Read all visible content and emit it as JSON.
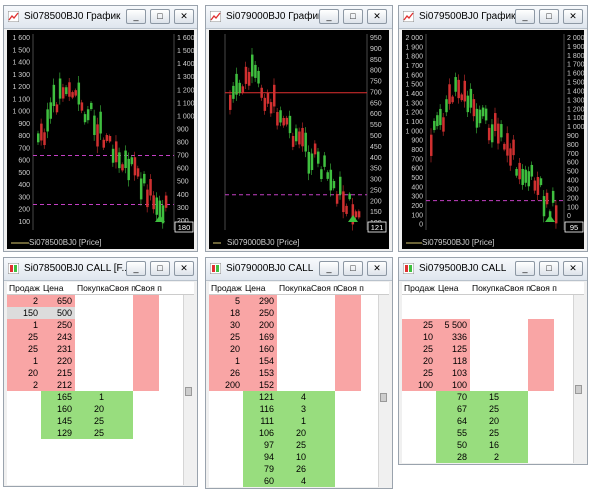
{
  "windows": [
    {
      "title": "Si078500BJ0 График",
      "legend": "Si078500BJ0 [Price]",
      "last_price": "180",
      "left_ticks": [
        "1 600",
        "1 500",
        "1 400",
        "1 300",
        "1 200",
        "1 100",
        "1 000",
        "900",
        "800",
        "700",
        "600",
        "500",
        "400",
        "300",
        "200",
        "100"
      ],
      "right_ticks": [
        "1 600",
        "1 500",
        "1 400",
        "1 300",
        "1 200",
        "1 100",
        "1 000",
        "900",
        "800",
        "700",
        "600",
        "500",
        "400",
        "300",
        "200"
      ]
    },
    {
      "title": "Si079000BJ0 График",
      "legend": "Si079000BJ0 [Price]",
      "last_price": "121",
      "left_ticks": [],
      "right_ticks": [
        "950",
        "900",
        "850",
        "800",
        "750",
        "700",
        "650",
        "600",
        "550",
        "500",
        "450",
        "400",
        "350",
        "300",
        "250",
        "200",
        "150",
        "100"
      ]
    },
    {
      "title": "Si079500BJ0 График",
      "legend": "Si079500BJ0 [Price]",
      "last_price": "95",
      "left_ticks": [
        "2 000",
        "1 900",
        "1 800",
        "1 700",
        "1 600",
        "1 500",
        "1 400",
        "1 300",
        "1 200",
        "1 100",
        "1 000",
        "900",
        "800",
        "700",
        "600",
        "500",
        "400",
        "300",
        "200",
        "100",
        "0"
      ],
      "right_ticks": [
        "2 000",
        "1 900",
        "1 800",
        "1 700",
        "1 600",
        "1 500",
        "1 400",
        "1 300",
        "1 200",
        "1 100",
        "1 000",
        "900",
        "800",
        "700",
        "600",
        "500",
        "400",
        "300",
        "200",
        "100",
        "0",
        "-100"
      ]
    }
  ],
  "books": [
    {
      "title": "Si078500BJ0 CALL [F...",
      "headers": [
        "Продаж",
        "Цена",
        "Покупка",
        "Своя п",
        "Своя п"
      ],
      "rows": [
        {
          "sell": "2",
          "price": "650",
          "buy": "",
          "t": "ask"
        },
        {
          "sell": "150",
          "price": "500",
          "buy": "",
          "t": "sel"
        },
        {
          "sell": "1",
          "price": "250",
          "buy": "",
          "t": "ask"
        },
        {
          "sell": "25",
          "price": "243",
          "buy": "",
          "t": "ask"
        },
        {
          "sell": "25",
          "price": "231",
          "buy": "",
          "t": "ask"
        },
        {
          "sell": "1",
          "price": "220",
          "buy": "",
          "t": "ask"
        },
        {
          "sell": "20",
          "price": "215",
          "buy": "",
          "t": "ask"
        },
        {
          "sell": "2",
          "price": "212",
          "buy": "",
          "t": "ask"
        },
        {
          "sell": "",
          "price": "165",
          "buy": "1",
          "t": "bid"
        },
        {
          "sell": "",
          "price": "160",
          "buy": "20",
          "t": "bid"
        },
        {
          "sell": "",
          "price": "145",
          "buy": "25",
          "t": "bid"
        },
        {
          "sell": "",
          "price": "129",
          "buy": "25",
          "t": "bid"
        }
      ]
    },
    {
      "title": "Si079000BJ0 CALL",
      "headers": [
        "Продаж",
        "Цена",
        "Покупка",
        "Своя п",
        "Своя п"
      ],
      "rows": [
        {
          "sell": "5",
          "price": "290",
          "buy": "",
          "t": "ask"
        },
        {
          "sell": "18",
          "price": "250",
          "buy": "",
          "t": "ask"
        },
        {
          "sell": "30",
          "price": "200",
          "buy": "",
          "t": "ask"
        },
        {
          "sell": "25",
          "price": "169",
          "buy": "",
          "t": "ask"
        },
        {
          "sell": "20",
          "price": "160",
          "buy": "",
          "t": "ask"
        },
        {
          "sell": "1",
          "price": "154",
          "buy": "",
          "t": "ask"
        },
        {
          "sell": "26",
          "price": "153",
          "buy": "",
          "t": "ask"
        },
        {
          "sell": "200",
          "price": "152",
          "buy": "",
          "t": "ask"
        },
        {
          "sell": "",
          "price": "121",
          "buy": "4",
          "t": "bid"
        },
        {
          "sell": "",
          "price": "116",
          "buy": "3",
          "t": "bid"
        },
        {
          "sell": "",
          "price": "111",
          "buy": "1",
          "t": "bid"
        },
        {
          "sell": "",
          "price": "106",
          "buy": "20",
          "t": "bid"
        },
        {
          "sell": "",
          "price": "97",
          "buy": "25",
          "t": "bid"
        },
        {
          "sell": "",
          "price": "94",
          "buy": "10",
          "t": "bid"
        },
        {
          "sell": "",
          "price": "79",
          "buy": "26",
          "t": "bid"
        },
        {
          "sell": "",
          "price": "60",
          "buy": "4",
          "t": "bid"
        }
      ]
    },
    {
      "title": "Si079500BJ0 CALL",
      "headers": [
        "Продаж",
        "Цена",
        "Покупка",
        "Своя п",
        "Своя п"
      ],
      "rows": [
        {
          "sell": "",
          "price": "",
          "buy": "",
          "t": "none"
        },
        {
          "sell": "",
          "price": "",
          "buy": "",
          "t": "none"
        },
        {
          "sell": "25",
          "price": "5 500",
          "buy": "",
          "t": "ask"
        },
        {
          "sell": "10",
          "price": "336",
          "buy": "",
          "t": "ask"
        },
        {
          "sell": "25",
          "price": "125",
          "buy": "",
          "t": "ask"
        },
        {
          "sell": "20",
          "price": "118",
          "buy": "",
          "t": "ask"
        },
        {
          "sell": "25",
          "price": "103",
          "buy": "",
          "t": "ask"
        },
        {
          "sell": "100",
          "price": "100",
          "buy": "",
          "t": "ask"
        },
        {
          "sell": "",
          "price": "70",
          "buy": "15",
          "t": "bid"
        },
        {
          "sell": "",
          "price": "67",
          "buy": "25",
          "t": "bid"
        },
        {
          "sell": "",
          "price": "64",
          "buy": "20",
          "t": "bid"
        },
        {
          "sell": "",
          "price": "55",
          "buy": "25",
          "t": "bid"
        },
        {
          "sell": "",
          "price": "50",
          "buy": "16",
          "t": "bid"
        },
        {
          "sell": "",
          "price": "28",
          "buy": "2",
          "t": "bid"
        }
      ]
    }
  ],
  "buttons": {
    "minimize": "_",
    "maximize": "□",
    "close": "✕"
  },
  "colors": {
    "ask": "#f9a5a5",
    "bid": "#98dd7e",
    "chart_bg": "#000000",
    "hline": "#c33fc3",
    "hline_red": "#e03030",
    "up": "#3fbf3f",
    "down": "#d03030"
  }
}
